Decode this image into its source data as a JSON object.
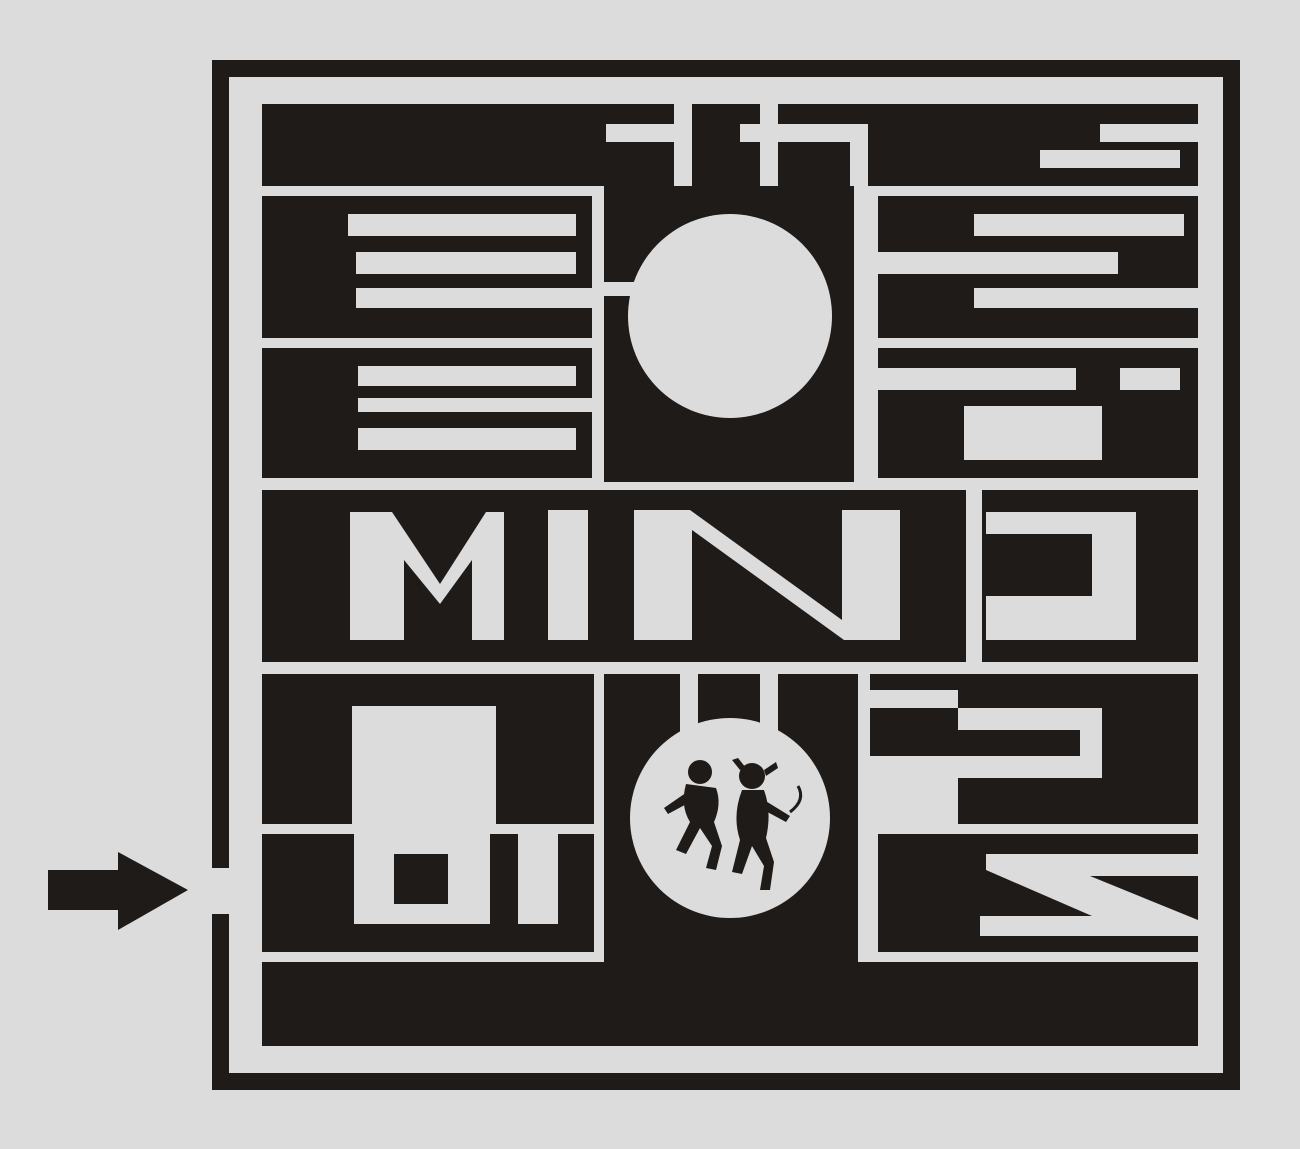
{
  "colors": {
    "background": "#dcdcdc",
    "ink": "#1e1b18"
  },
  "logo": {
    "lettering": "MIND",
    "description": "labyrinth-logo"
  },
  "entry_arrow": {
    "icon": "arrow-right-icon"
  },
  "medallion": {
    "icon": "hero-and-minotaur-figure-icon"
  }
}
